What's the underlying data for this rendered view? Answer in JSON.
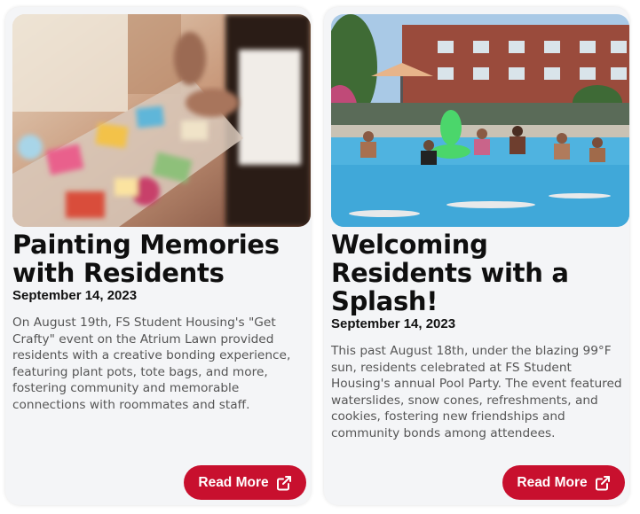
{
  "articles": [
    {
      "title": "Painting Memories with Residents",
      "date": "September 14, 2023",
      "body": "On August 19th, FS Student Housing's \"Get Crafty\" event on the Atrium Lawn provided residents with a creative bonding experience, featuring plant pots, tote bags, and more, fostering community and memorable connections with roommates and staff.",
      "button_label": "Read More",
      "button_icon": "external-link-icon",
      "image_subject": "crafting-table-photo"
    },
    {
      "title": "Welcoming Residents with a Splash!",
      "date": "September 14, 2023",
      "body": "This past August 18th, under the blazing 99°F sun, residents celebrated at FS Student Housing's annual Pool Party. The event featured waterslides, snow cones, refreshments, and cookies, fostering new friendships and community bonds among attendees.",
      "button_label": "Read More",
      "button_icon": "external-link-icon",
      "image_subject": "pool-party-photo"
    }
  ],
  "colors": {
    "accent": "#c8102e",
    "card_bg": "#f4f5f7",
    "title": "#0f0f0f",
    "body_text": "#555555"
  }
}
